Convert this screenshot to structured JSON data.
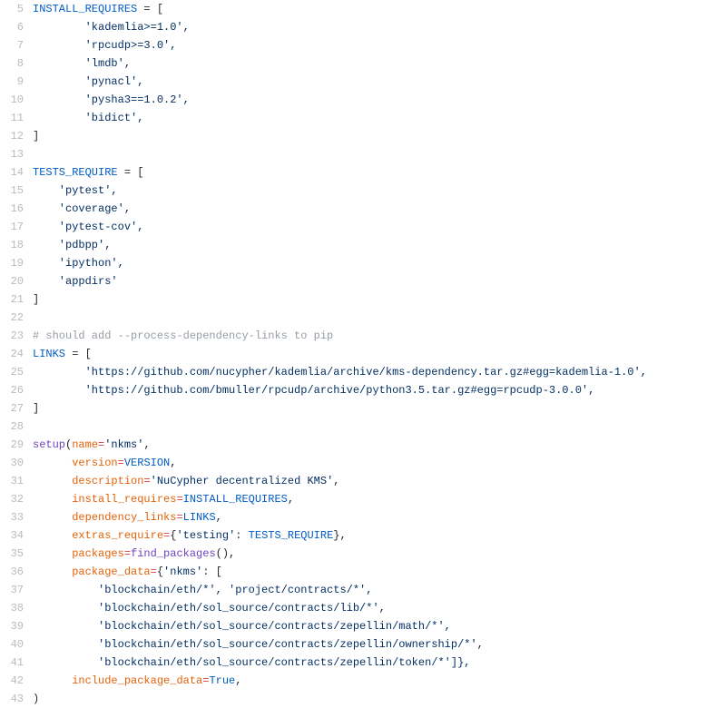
{
  "lines": {
    "g5": "5",
    "g6": "6",
    "g7": "7",
    "g8": "8",
    "g9": "9",
    "g10": "10",
    "g11": "11",
    "g12": "12",
    "g13": "13",
    "g14": "14",
    "g15": "15",
    "g16": "16",
    "g17": "17",
    "g18": "18",
    "g19": "19",
    "g20": "20",
    "g21": "21",
    "g22": "22",
    "g23": "23",
    "g24": "24",
    "g25": "25",
    "g26": "26",
    "g27": "27",
    "g28": "28",
    "g29": "29",
    "g30": "30",
    "g31": "31",
    "g32": "32",
    "g33": "33",
    "g34": "34",
    "g35": "35",
    "g36": "36",
    "g37": "37",
    "g38": "38",
    "g39": "39",
    "g40": "40",
    "g41": "41",
    "g42": "42",
    "g43": "43"
  },
  "code": {
    "l5_var": "INSTALL_REQUIRES",
    "l5_rest": " = [",
    "l6": "        'kademlia>=1.0',",
    "l7": "        'rpcudp>=3.0',",
    "l8": "        'lmdb',",
    "l9": "        'pynacl',",
    "l10": "        'pysha3==1.0.2',",
    "l11": "        'bidict',",
    "l12": "]",
    "l13": "",
    "l14_var": "TESTS_REQUIRE",
    "l14_rest": " = [",
    "l15": "    'pytest',",
    "l16": "    'coverage',",
    "l17": "    'pytest-cov',",
    "l18": "    'pdbpp',",
    "l19": "    'ipython',",
    "l20": "    'appdirs'",
    "l21": "]",
    "l22": "",
    "l23": "# should add --process-dependency-links to pip",
    "l24_var": "LINKS",
    "l24_rest": " = [",
    "l25": "        'https://github.com/nucypher/kademlia/archive/kms-dependency.tar.gz#egg=kademlia-1.0',",
    "l26": "        'https://github.com/bmuller/rpcudp/archive/python3.5.tar.gz#egg=rpcudp-3.0.0',",
    "l27": "]",
    "l28": "",
    "l29_fn": "setup",
    "l29_open": "(",
    "l29_arg": "name",
    "l29_eq": "=",
    "l29_val": "'nkms'",
    "l29_comma": ",",
    "l30_arg": "version",
    "l30_eq": "=",
    "l30_val": "VERSION",
    "l30_comma": ",",
    "l31_arg": "description",
    "l31_eq": "=",
    "l31_val": "'NuCypher decentralized KMS'",
    "l31_comma": ",",
    "l32_arg": "install_requires",
    "l32_eq": "=",
    "l32_val": "INSTALL_REQUIRES",
    "l32_comma": ",",
    "l33_arg": "dependency_links",
    "l33_eq": "=",
    "l33_val": "LINKS",
    "l33_comma": ",",
    "l34_arg": "extras_require",
    "l34_eq": "=",
    "l34_open": "{",
    "l34_key": "'testing'",
    "l34_colon": ": ",
    "l34_val": "TESTS_REQUIRE",
    "l34_close": "},",
    "l35_arg": "packages",
    "l35_eq": "=",
    "l35_fn": "find_packages",
    "l35_rest": "(),",
    "l36_arg": "package_data",
    "l36_eq": "=",
    "l36_open": "{",
    "l36_key": "'nkms'",
    "l36_rest": ": [",
    "l37": "          'blockchain/eth/*', 'project/contracts/*',",
    "l38": "          'blockchain/eth/sol_source/contracts/lib/*',",
    "l39": "          'blockchain/eth/sol_source/contracts/zepellin/math/*',",
    "l40": "          'blockchain/eth/sol_source/contracts/zepellin/ownership/*',",
    "l41": "          'blockchain/eth/sol_source/contracts/zepellin/token/*']},",
    "l42_arg": "include_package_data",
    "l42_eq": "=",
    "l42_val": "True",
    "l42_comma": ",",
    "l43": ")"
  }
}
